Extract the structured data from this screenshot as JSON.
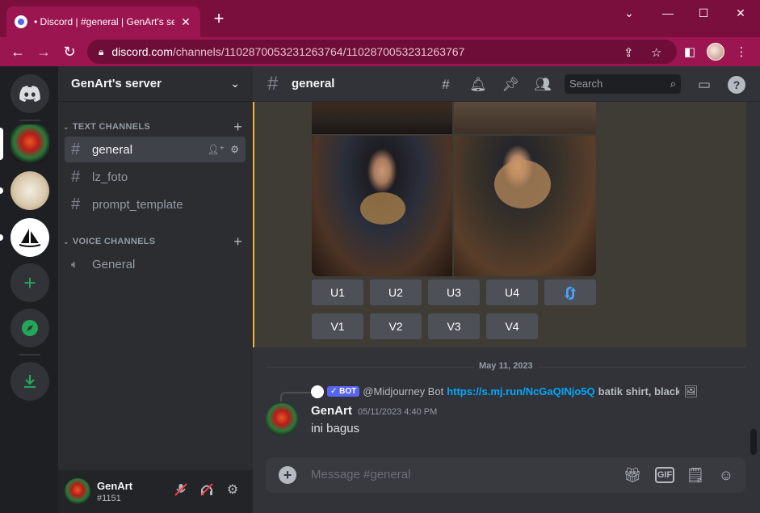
{
  "browser": {
    "tab_title": "• Discord | #general | GenArt's se",
    "url_host": "discord.com",
    "url_path": "/channels/1102870053231263764/1102870053231263767"
  },
  "server": {
    "name": "GenArt's server"
  },
  "sidebar": {
    "text_category": "TEXT CHANNELS",
    "voice_category": "VOICE CHANNELS",
    "text_channels": [
      {
        "label": "general"
      },
      {
        "label": "lz_foto"
      },
      {
        "label": "prompt_template"
      }
    ],
    "voice_channels": [
      {
        "label": "General"
      }
    ]
  },
  "user": {
    "name": "GenArt",
    "tag": "#1151"
  },
  "channel": {
    "title": "general",
    "search_placeholder": "Search"
  },
  "midjourney": {
    "upscale_buttons": [
      "U1",
      "U2",
      "U3",
      "U4"
    ],
    "variation_buttons": [
      "V1",
      "V2",
      "V3",
      "V4"
    ]
  },
  "messages": {
    "date_divider": "May 11, 2023",
    "reply": {
      "bot_tag": "BOT",
      "user": "@Midjourney Bot",
      "link": "https://s.mj.run/NcGaQINjo5Q",
      "text": "batik shirt, black"
    },
    "author": "GenArt",
    "timestamp": "05/11/2023 4:40 PM",
    "body": "ini bagus"
  },
  "composer": {
    "placeholder": "Message #general",
    "gif_label": "GIF"
  },
  "colors": {
    "accent": "#5865f2",
    "highlight_border": "#f0b232",
    "link": "#00a8fc",
    "green": "#23a55a",
    "browser_frame": "#9b1550"
  }
}
